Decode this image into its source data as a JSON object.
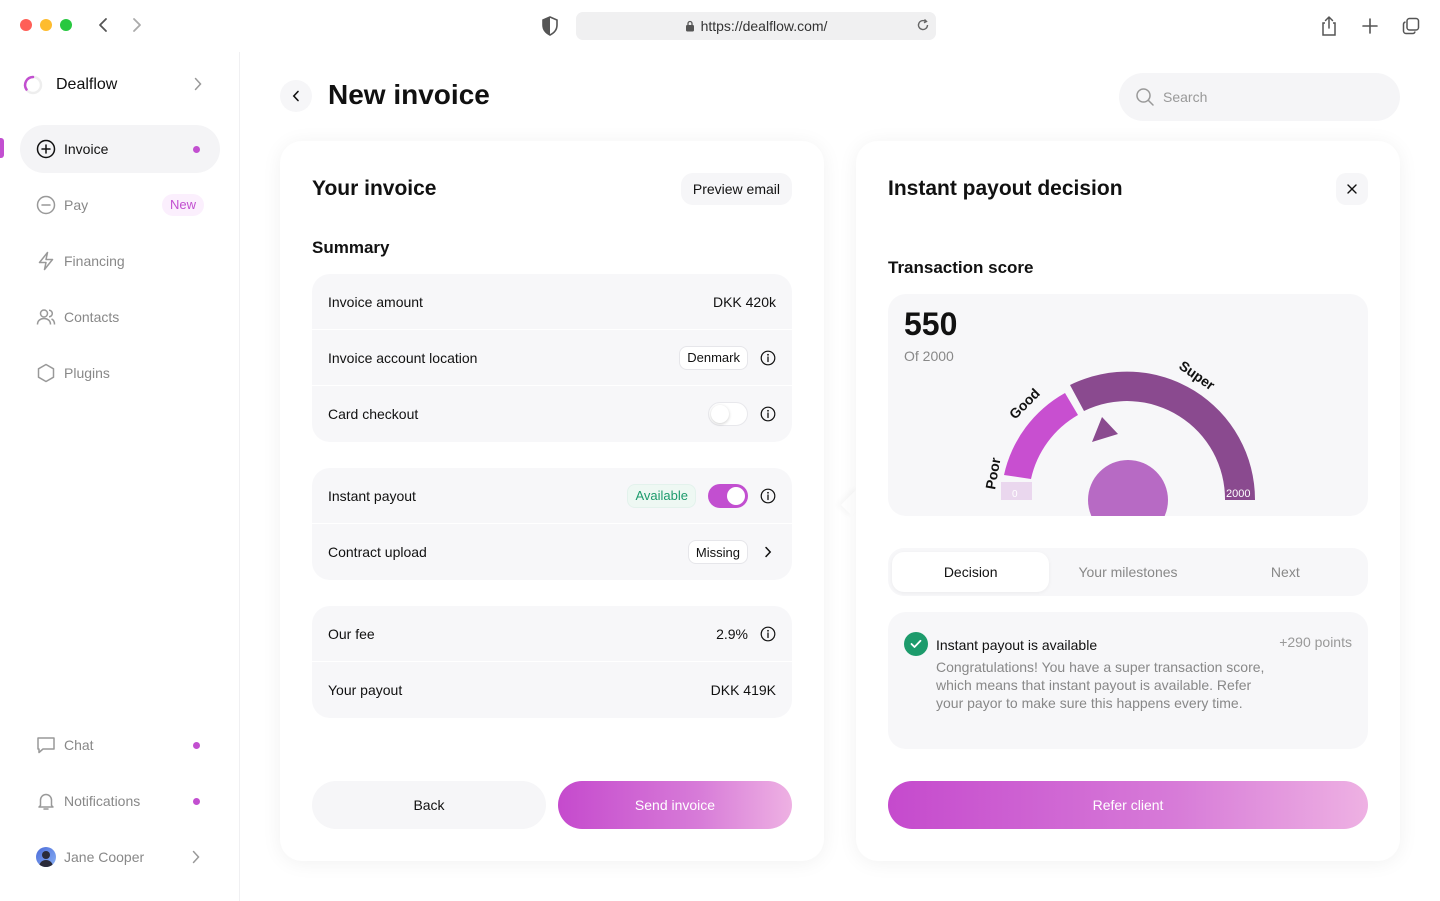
{
  "browser": {
    "url": "https://dealflow.com/"
  },
  "sidebar": {
    "brand": "Dealflow",
    "items": [
      {
        "label": "Invoice",
        "icon": "plus-circle-icon",
        "active": true,
        "dot": true
      },
      {
        "label": "Pay",
        "icon": "minus-circle-icon",
        "badge": "New"
      },
      {
        "label": "Financing",
        "icon": "lightning-icon"
      },
      {
        "label": "Contacts",
        "icon": "people-icon"
      },
      {
        "label": "Plugins",
        "icon": "hexagon-icon"
      }
    ],
    "bottom": [
      {
        "label": "Chat",
        "icon": "chat-icon",
        "dot": true
      },
      {
        "label": "Notifications",
        "icon": "bell-icon",
        "dot": true
      },
      {
        "label": "Jane Cooper",
        "icon": "avatar"
      }
    ]
  },
  "header": {
    "title": "New invoice",
    "search_placeholder": "Search"
  },
  "invoice": {
    "title": "Your invoice",
    "preview_label": "Preview email",
    "summary_title": "Summary",
    "rows": {
      "amount_label": "Invoice amount",
      "amount_value": "DKK 420k",
      "location_label": "Invoice account location",
      "location_value": "Denmark",
      "card_label": "Card checkout",
      "card_checkout_enabled": false,
      "instant_label": "Instant payout",
      "instant_status": "Available",
      "instant_payout_enabled": true,
      "contract_label": "Contract upload",
      "contract_status": "Missing",
      "fee_label": "Our fee",
      "fee_value": "2.9%",
      "payout_label": "Your payout",
      "payout_value": "DKK 419K"
    },
    "back_label": "Back",
    "send_label": "Send invoice"
  },
  "decision": {
    "title": "Instant payout decision",
    "score_title": "Transaction score",
    "score": "550",
    "score_sub": "Of 2000",
    "gauge_labels": {
      "poor": "Poor",
      "good": "Good",
      "super": "Super",
      "min": "0",
      "max": "2000"
    },
    "colors": {
      "accent": "#c24fd0",
      "poor": "#ead7ee",
      "good": "#c84fd0",
      "super": "#8a4a8f",
      "center": "#b76ac4",
      "success": "#1d9b6c"
    },
    "tabs": [
      "Decision",
      "Your milestones",
      "Next"
    ],
    "active_tab": "Decision",
    "card_title": "Instant payout is available",
    "card_points": "+290 points",
    "card_body": "Congratulations! You have a super transaction score, which means that instant payout is available. Refer your payor to make sure this happens every time.",
    "refer_label": "Refer client"
  }
}
